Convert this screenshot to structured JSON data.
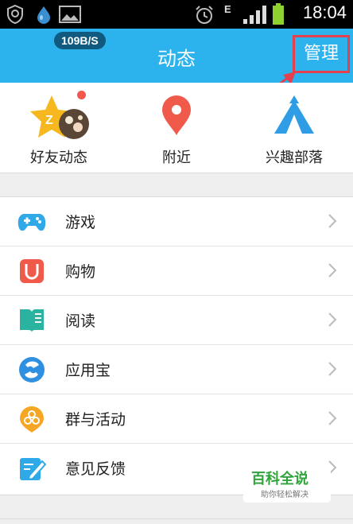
{
  "status_bar": {
    "time": "18:04",
    "icons": [
      "shield-icon",
      "water-drop-icon",
      "image-icon",
      "alarm-clock-icon",
      "data-E-icon",
      "signal-icon",
      "battery-icon"
    ],
    "network_label": "E"
  },
  "header": {
    "speed_badge": "109B/S",
    "title": "动态",
    "manage_label": "管理",
    "background_color": "#2cb3ee",
    "highlight_color": "#e2414d"
  },
  "quick_entries": [
    {
      "label": "好友动态",
      "icon": "qzone-star-icon",
      "has_dot": true
    },
    {
      "label": "附近",
      "icon": "location-pin-icon"
    },
    {
      "label": "兴趣部落",
      "icon": "tent-icon"
    }
  ],
  "list": {
    "items": [
      {
        "label": "游戏",
        "icon": "gamepad-icon",
        "color": "#2fa9e8"
      },
      {
        "label": "购物",
        "icon": "shopping-bag-icon",
        "color": "#f05a4a"
      },
      {
        "label": "阅读",
        "icon": "book-icon",
        "color": "#29b3a0"
      },
      {
        "label": "应用宝",
        "icon": "app-store-icon",
        "color": "#2f8fe0"
      },
      {
        "label": "群与活动",
        "icon": "group-activity-icon",
        "color": "#f5a623"
      },
      {
        "label": "意见反馈",
        "icon": "feedback-icon",
        "color": "#2fa9e8"
      }
    ]
  },
  "watermark": {
    "title": "百科全说",
    "subtitle": "助你轻松解决"
  }
}
